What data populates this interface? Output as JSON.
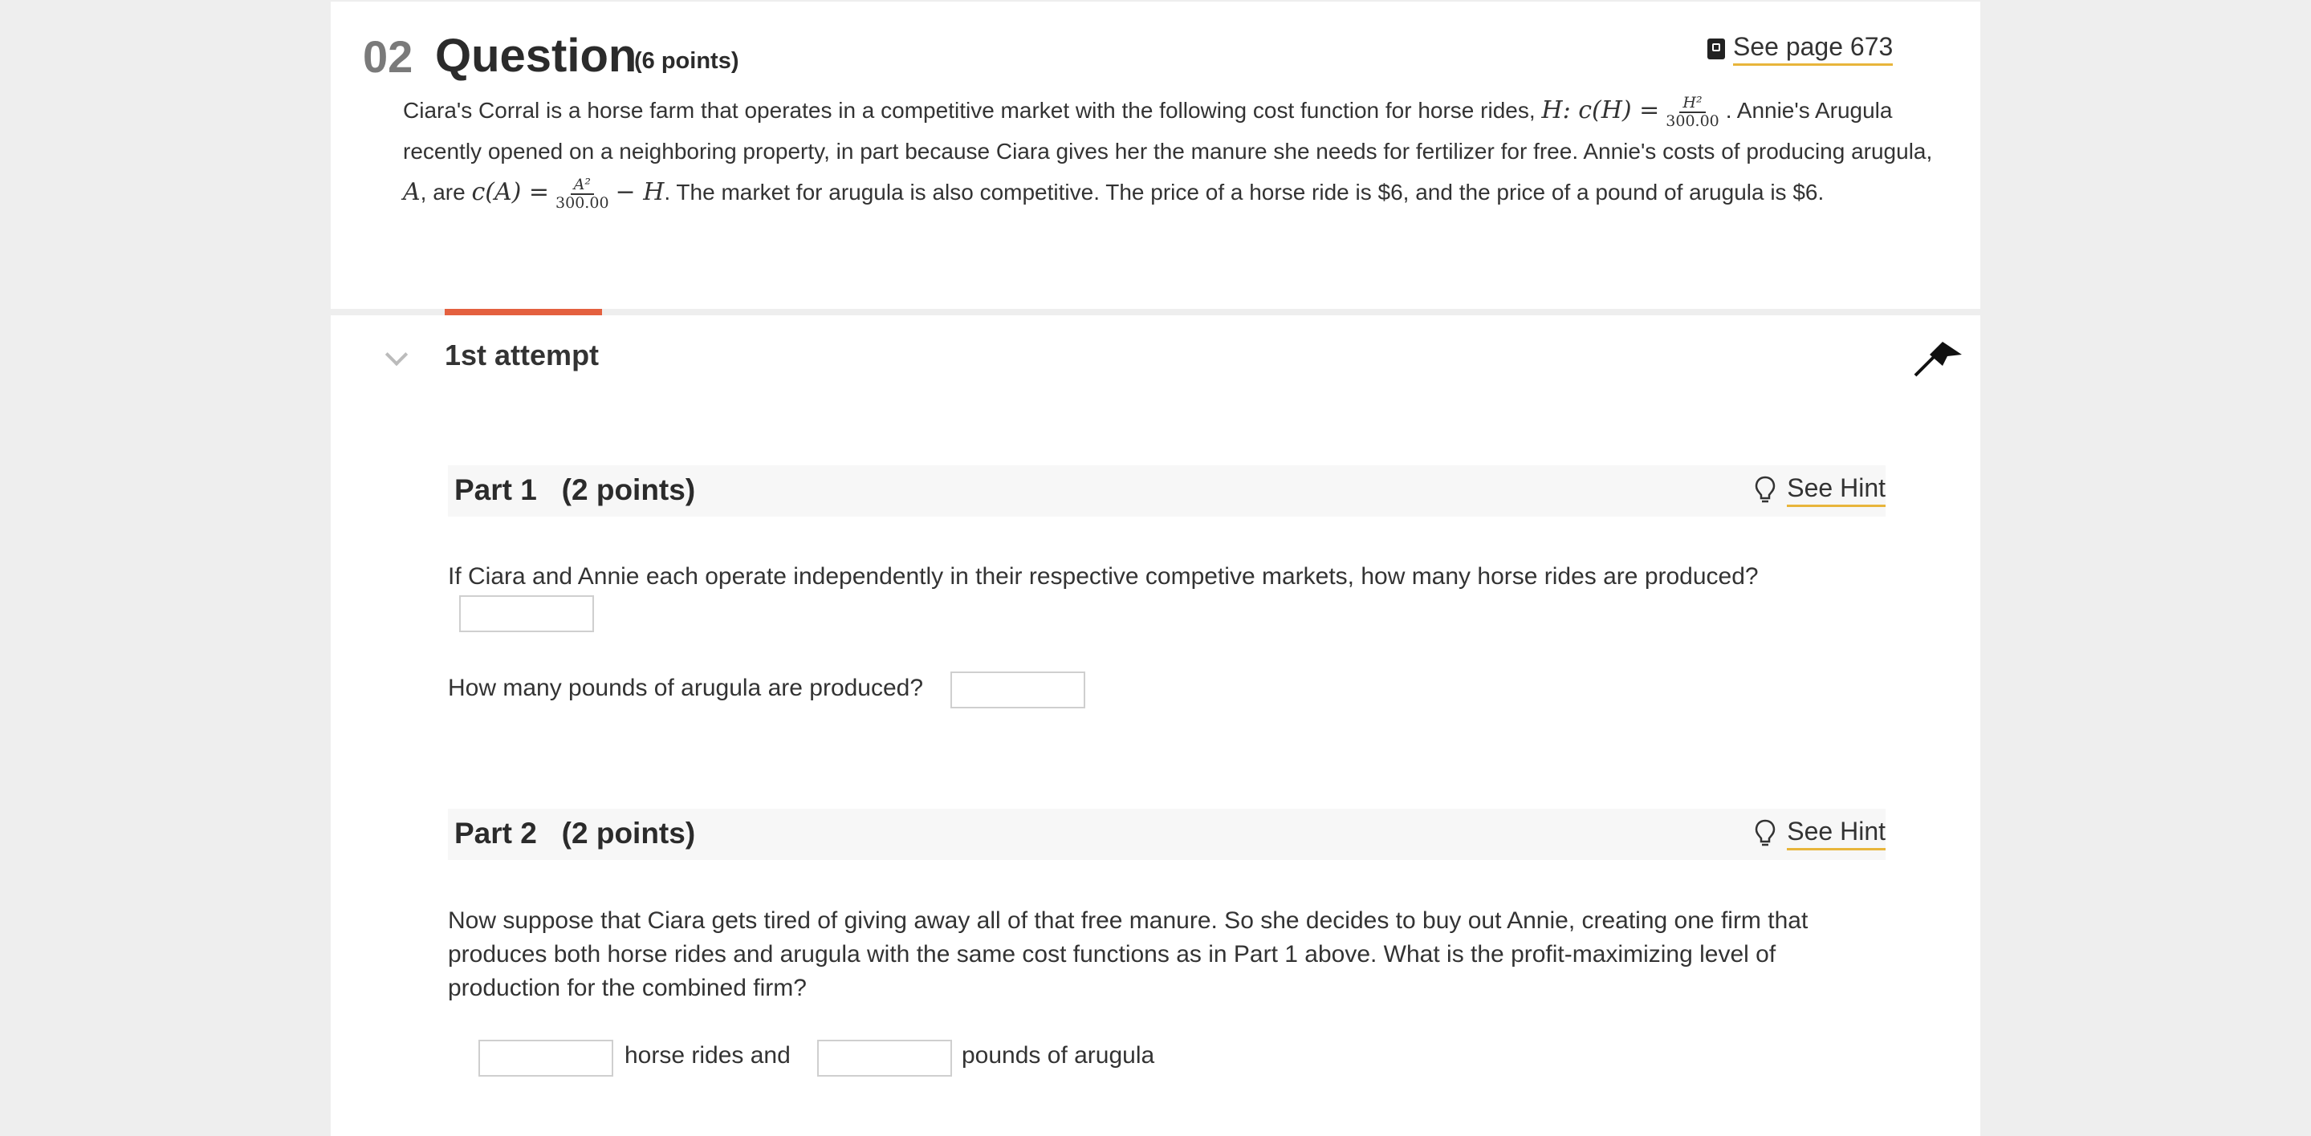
{
  "question": {
    "number": "02",
    "title": "Question",
    "points": "(6 points)",
    "see_page": "See page 673",
    "stem": {
      "t1": "Ciara's Corral is a horse farm that operates in a competitive market with the following cost function for horse rides, ",
      "m1": "H: c(H) =",
      "f1_num": "H²",
      "f1_den": "300.00",
      "t2": ". Annie's Arugula recently opened on a neighboring property, in part because Ciara gives her the manure she needs for fertilizer for free. Annie's costs of producing arugula, ",
      "m2": "A",
      "t3": ", are ",
      "m3": "c(A) =",
      "f2_num": "A²",
      "f2_den": "300.00",
      "m4": "− H",
      "t4": ". The market for arugula is also competitive. The price of a horse ride is $6, and the price of a pound of arugula is $6."
    }
  },
  "attempt": {
    "label": "1st attempt"
  },
  "parts": [
    {
      "title": "Part 1   (2 points)",
      "hint": "See Hint",
      "q1": "If Ciara and Annie each operate independently in their respective competive markets, how many horse rides are produced?",
      "q2": "How many pounds of arugula are produced?",
      "q1_value": "",
      "q2_value": ""
    },
    {
      "title": "Part 2   (2 points)",
      "hint": "See Hint",
      "text": "Now suppose that Ciara gets tired of giving away all of that free manure. So she decides to buy out Annie, creating one firm that produces both horse rides and arugula with the same cost functions as in Part 1 above. What is the profit-maximizing level of production for the combined firm?",
      "label_a": "horse rides and",
      "label_b": "pounds of arugula",
      "value_a": "",
      "value_b": ""
    }
  ],
  "colors": {
    "accent": "#e4603f",
    "link_underline": "#e8b53b",
    "page_bg": "#eeeeee"
  },
  "icons": [
    "book-icon",
    "chevron-down-icon",
    "flag-icon",
    "lightbulb-icon"
  ]
}
